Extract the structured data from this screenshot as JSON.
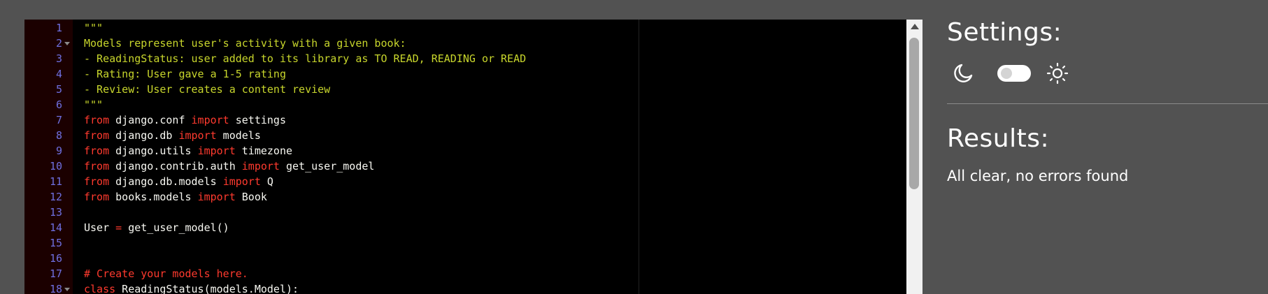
{
  "editor": {
    "lines": [
      {
        "num": "1",
        "fold": false,
        "kind": "string",
        "segments": [
          {
            "t": "\"\"\"",
            "c": ""
          }
        ]
      },
      {
        "num": "2",
        "fold": true,
        "kind": "string",
        "segments": [
          {
            "t": "Models represent user's activity with a given book:",
            "c": ""
          }
        ]
      },
      {
        "num": "3",
        "fold": false,
        "kind": "string",
        "segments": [
          {
            "t": "- ReadingStatus: user added to its library as TO READ, READING or READ",
            "c": ""
          }
        ]
      },
      {
        "num": "4",
        "fold": false,
        "kind": "string",
        "segments": [
          {
            "t": "- Rating: User gave a 1-5 rating",
            "c": ""
          }
        ]
      },
      {
        "num": "5",
        "fold": false,
        "kind": "string",
        "segments": [
          {
            "t": "- Review: User creates a content review",
            "c": ""
          }
        ]
      },
      {
        "num": "6",
        "fold": false,
        "kind": "string",
        "segments": [
          {
            "t": "\"\"\"",
            "c": ""
          }
        ]
      },
      {
        "num": "7",
        "fold": false,
        "kind": "code",
        "segments": [
          {
            "t": "from",
            "c": "kw"
          },
          {
            "t": " django.conf ",
            "c": ""
          },
          {
            "t": "import",
            "c": "kw"
          },
          {
            "t": " settings",
            "c": ""
          }
        ]
      },
      {
        "num": "8",
        "fold": false,
        "kind": "code",
        "segments": [
          {
            "t": "from",
            "c": "kw"
          },
          {
            "t": " django.db ",
            "c": ""
          },
          {
            "t": "import",
            "c": "kw"
          },
          {
            "t": " models",
            "c": ""
          }
        ]
      },
      {
        "num": "9",
        "fold": false,
        "kind": "code",
        "segments": [
          {
            "t": "from",
            "c": "kw"
          },
          {
            "t": " django.utils ",
            "c": ""
          },
          {
            "t": "import",
            "c": "kw"
          },
          {
            "t": " timezone",
            "c": ""
          }
        ]
      },
      {
        "num": "10",
        "fold": false,
        "kind": "code",
        "segments": [
          {
            "t": "from",
            "c": "kw"
          },
          {
            "t": " django.contrib.auth ",
            "c": ""
          },
          {
            "t": "import",
            "c": "kw"
          },
          {
            "t": " get_user_model",
            "c": ""
          }
        ]
      },
      {
        "num": "11",
        "fold": false,
        "kind": "code",
        "segments": [
          {
            "t": "from",
            "c": "kw"
          },
          {
            "t": " django.db.models ",
            "c": ""
          },
          {
            "t": "import",
            "c": "kw"
          },
          {
            "t": " Q",
            "c": ""
          }
        ]
      },
      {
        "num": "12",
        "fold": false,
        "kind": "code",
        "segments": [
          {
            "t": "from",
            "c": "kw"
          },
          {
            "t": " books.models ",
            "c": ""
          },
          {
            "t": "import",
            "c": "kw"
          },
          {
            "t": " Book",
            "c": ""
          }
        ]
      },
      {
        "num": "13",
        "fold": false,
        "kind": "code",
        "segments": []
      },
      {
        "num": "14",
        "fold": false,
        "kind": "code",
        "segments": [
          {
            "t": "User ",
            "c": ""
          },
          {
            "t": "=",
            "c": "op"
          },
          {
            "t": " get_user_model()",
            "c": ""
          }
        ]
      },
      {
        "num": "15",
        "fold": false,
        "kind": "code",
        "segments": []
      },
      {
        "num": "16",
        "fold": false,
        "kind": "code",
        "segments": []
      },
      {
        "num": "17",
        "fold": false,
        "kind": "comment",
        "segments": [
          {
            "t": "# Create your models here.",
            "c": ""
          }
        ]
      },
      {
        "num": "18",
        "fold": true,
        "kind": "code",
        "segments": [
          {
            "t": "class",
            "c": "kw"
          },
          {
            "t": " ReadingStatus(models.Model):",
            "c": ""
          }
        ]
      }
    ]
  },
  "settings": {
    "title": "Settings:",
    "theme": {
      "dark_icon": "moon-icon",
      "light_icon": "sun-icon",
      "toggle_on": false
    }
  },
  "results": {
    "title": "Results:",
    "message": "All clear, no errors found"
  },
  "colors": {
    "background": "#525252",
    "editor_bg": "#000000",
    "gutter_bg": "#1b0000",
    "keyword": "#ff3a2e",
    "string": "#c8d62c",
    "line_number": "#6f6fe0"
  }
}
